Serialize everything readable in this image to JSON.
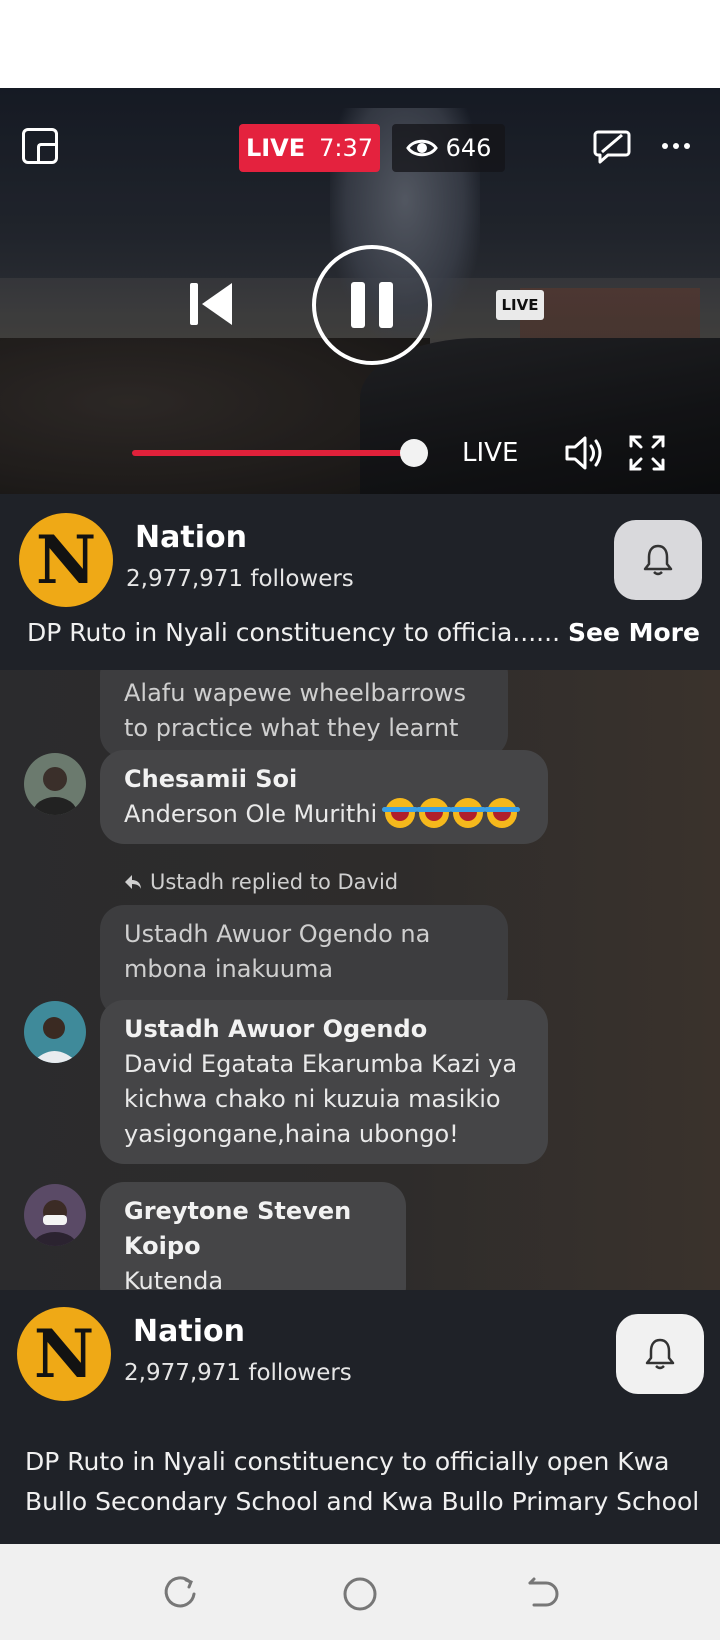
{
  "player": {
    "live_label": "LIVE",
    "live_time": "7:37",
    "viewer_count": "646",
    "live_tag": "LIVE",
    "progress_live_label": "LIVE",
    "progress_fraction": 0.95
  },
  "channel": {
    "logo_letter": "N",
    "name": "Nation",
    "followers": "2,977,971 followers",
    "description_truncated": "DP Ruto in Nyali constituency to officia......",
    "see_more": "See More",
    "brand_color": "#efa916"
  },
  "chat": {
    "messages": [
      {
        "text": "Alafu wapewe wheelbarrows to practice what they learnt"
      },
      {
        "author": "Chesamii Soi",
        "text": "Anderson Ole Murithi",
        "emoji": "😂😂😂😂"
      },
      {
        "reply_note": "Ustadh replied to David",
        "quoted": "Ustadh Awuor Ogendo na mbona inakuuma"
      },
      {
        "author": "Ustadh Awuor Ogendo",
        "text": "David Egatata Ekarumba Kazi ya kichwa chako ni kuzuia masikio yasigongane,haina ubongo!"
      },
      {
        "author": "Greytone Steven Koipo",
        "text": "Kutenda"
      }
    ]
  },
  "channel_footer": {
    "logo_letter": "N",
    "name": "Nation",
    "followers": "2,977,971 followers",
    "description": "DP Ruto in Nyali constituency to officially open Kwa Bullo Secondary School and Kwa Bullo Primary School"
  },
  "colors": {
    "live_red": "#e4223e",
    "panel_bg": "#1f2228"
  }
}
